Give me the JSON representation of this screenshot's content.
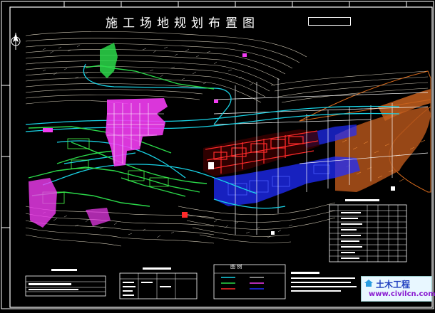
{
  "drawing": {
    "title": "施工场地规划布置图",
    "legend_heading": "图 例"
  },
  "watermark": {
    "main": "土木工程",
    "sub": "www.civilcn.com"
  },
  "colors": {
    "background": "#000000",
    "frame": "#ffffff",
    "contour": "#e8e2d2",
    "road": "#19d3e6",
    "green_area": "#2bd94a",
    "magenta_area": "#f23cf2",
    "red_area": "#ff2a2a",
    "blue_area": "#1f2cff",
    "orange_area": "#d66a1c"
  }
}
